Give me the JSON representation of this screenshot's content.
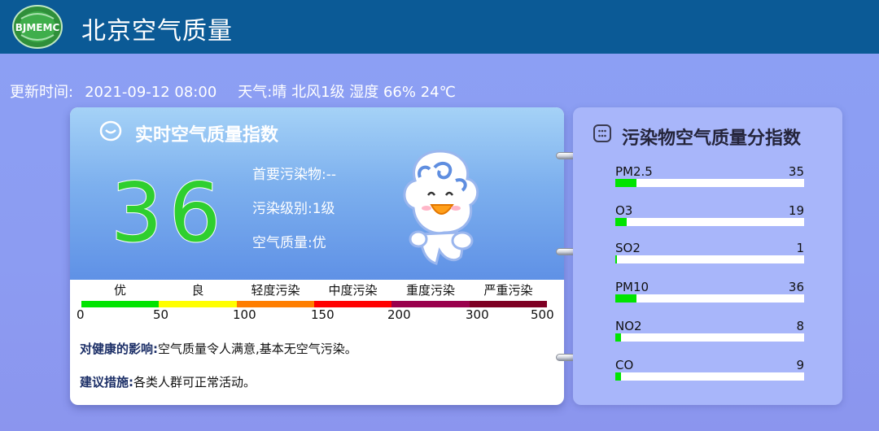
{
  "header": {
    "app_title": "北京空气质量",
    "logo_text": "BJMEMC"
  },
  "info": {
    "update_label": "更新时间:",
    "update_time": "2021-09-12 08:00",
    "weather_label": "天气:",
    "weather_value": "晴 北风1级 湿度 66% 24℃"
  },
  "aqi_card": {
    "title": "实时空气质量指数",
    "aqi_value": "36",
    "aqi_color": "#2fcf2f",
    "primary_pollutant": "首要污染物:--",
    "pollution_level": "污染级别:1级",
    "air_quality": "空气质量:优",
    "scale": {
      "levels": [
        {
          "label": "优",
          "color": "#00e400",
          "from": 0,
          "to": 50
        },
        {
          "label": "良",
          "color": "#ffff00",
          "from": 50,
          "to": 100
        },
        {
          "label": "轻度污染",
          "color": "#ff7e00",
          "from": 100,
          "to": 150
        },
        {
          "label": "中度污染",
          "color": "#ff0000",
          "from": 150,
          "to": 200
        },
        {
          "label": "重度污染",
          "color": "#99004c",
          "from": 200,
          "to": 300
        },
        {
          "label": "严重污染",
          "color": "#7e0023",
          "from": 300,
          "to": 500
        }
      ],
      "ticks": [
        "0",
        "50",
        "100",
        "150",
        "200",
        "300",
        "500"
      ]
    },
    "health_label": "对健康的影响:",
    "health_text": "空气质量令人满意,基本无空气污染。",
    "advice_label": "建议措施:",
    "advice_text": "各类人群可正常活动。"
  },
  "pollutant_card": {
    "title": "污染物空气质量分指数",
    "bar_color": "#00e400",
    "items": [
      {
        "name": "PM2.5",
        "value": "35",
        "fill": 0.11
      },
      {
        "name": "O3",
        "value": "19",
        "fill": 0.06
      },
      {
        "name": "SO2",
        "value": "1",
        "fill": 0.005
      },
      {
        "name": "PM10",
        "value": "36",
        "fill": 0.11
      },
      {
        "name": "NO2",
        "value": "8",
        "fill": 0.03
      },
      {
        "name": "CO",
        "value": "9",
        "fill": 0.03
      }
    ]
  },
  "icons": {
    "logo": "bjmemc-logo",
    "title_icon": "smile-face-icon",
    "poll_icon": "grid-icon",
    "mascot": "cloud-mascot"
  }
}
